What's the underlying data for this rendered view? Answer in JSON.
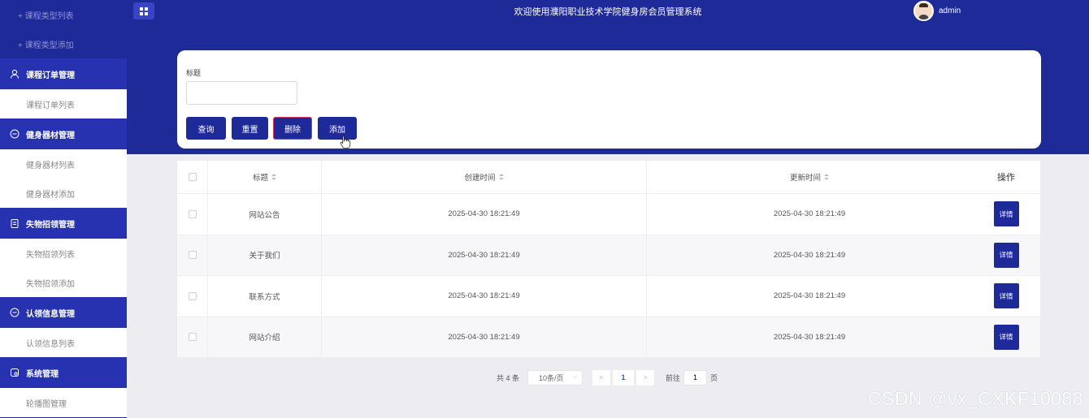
{
  "sidebar": {
    "items": [
      {
        "type": "sub",
        "label": "+ 课程类型列表"
      },
      {
        "type": "sub",
        "label": "+ 课程类型添加"
      },
      {
        "type": "group",
        "label": "课程订单管理",
        "icon": "user-icon"
      },
      {
        "type": "sub-active",
        "label": "课程订单列表"
      },
      {
        "type": "group",
        "label": "健身器材管理",
        "icon": "chat-icon"
      },
      {
        "type": "sub",
        "label": "健身器材列表"
      },
      {
        "type": "sub",
        "label": "健身器材添加"
      },
      {
        "type": "group",
        "label": "失物招领管理",
        "icon": "clipboard-icon"
      },
      {
        "type": "sub",
        "label": "失物招领列表"
      },
      {
        "type": "sub",
        "label": "失物招领添加"
      },
      {
        "type": "group",
        "label": "认领信息管理",
        "icon": "chat-icon"
      },
      {
        "type": "sub",
        "label": "认领信息列表"
      },
      {
        "type": "group",
        "label": "系统管理",
        "icon": "settings-doc-icon"
      },
      {
        "type": "sub-active",
        "label": "轮播图管理"
      }
    ]
  },
  "header": {
    "title": "欢迎使用濮阳职业技术学院健身房会员管理系统",
    "username": "admin",
    "menu_icon": "grid-menu-icon"
  },
  "search": {
    "label": "标题",
    "value": "",
    "buttons": {
      "query": "查询",
      "reset": "重置",
      "delete": "删除",
      "add": "添加"
    }
  },
  "table": {
    "columns": {
      "title": "标题",
      "created": "创建时间",
      "updated": "更新时间",
      "op": "操作"
    },
    "rows": [
      {
        "title": "网站公告",
        "created": "2025-04-30 18:21:49",
        "updated": "2025-04-30 18:21:49",
        "action": "详情"
      },
      {
        "title": "关于我们",
        "created": "2025-04-30 18:21:49",
        "updated": "2025-04-30 18:21:49",
        "action": "详情"
      },
      {
        "title": "联系方式",
        "created": "2025-04-30 18:21:49",
        "updated": "2025-04-30 18:21:49",
        "action": "详情"
      },
      {
        "title": "网站介绍",
        "created": "2025-04-30 18:21:49",
        "updated": "2025-04-30 18:21:49",
        "action": "详情"
      }
    ]
  },
  "pagination": {
    "total": "共 4 条",
    "page_size": "10条/页",
    "prev": "<",
    "current": "1",
    "next": ">",
    "goto_label": "前往",
    "goto_value": "1",
    "page_suffix": "页"
  },
  "watermark": "CSDN @vx_CXKF10088",
  "colors": {
    "primary": "#1f2a99",
    "sidebar_group": "#2732b0",
    "background": "#ececf1",
    "delete_border": "#d23b5e"
  }
}
